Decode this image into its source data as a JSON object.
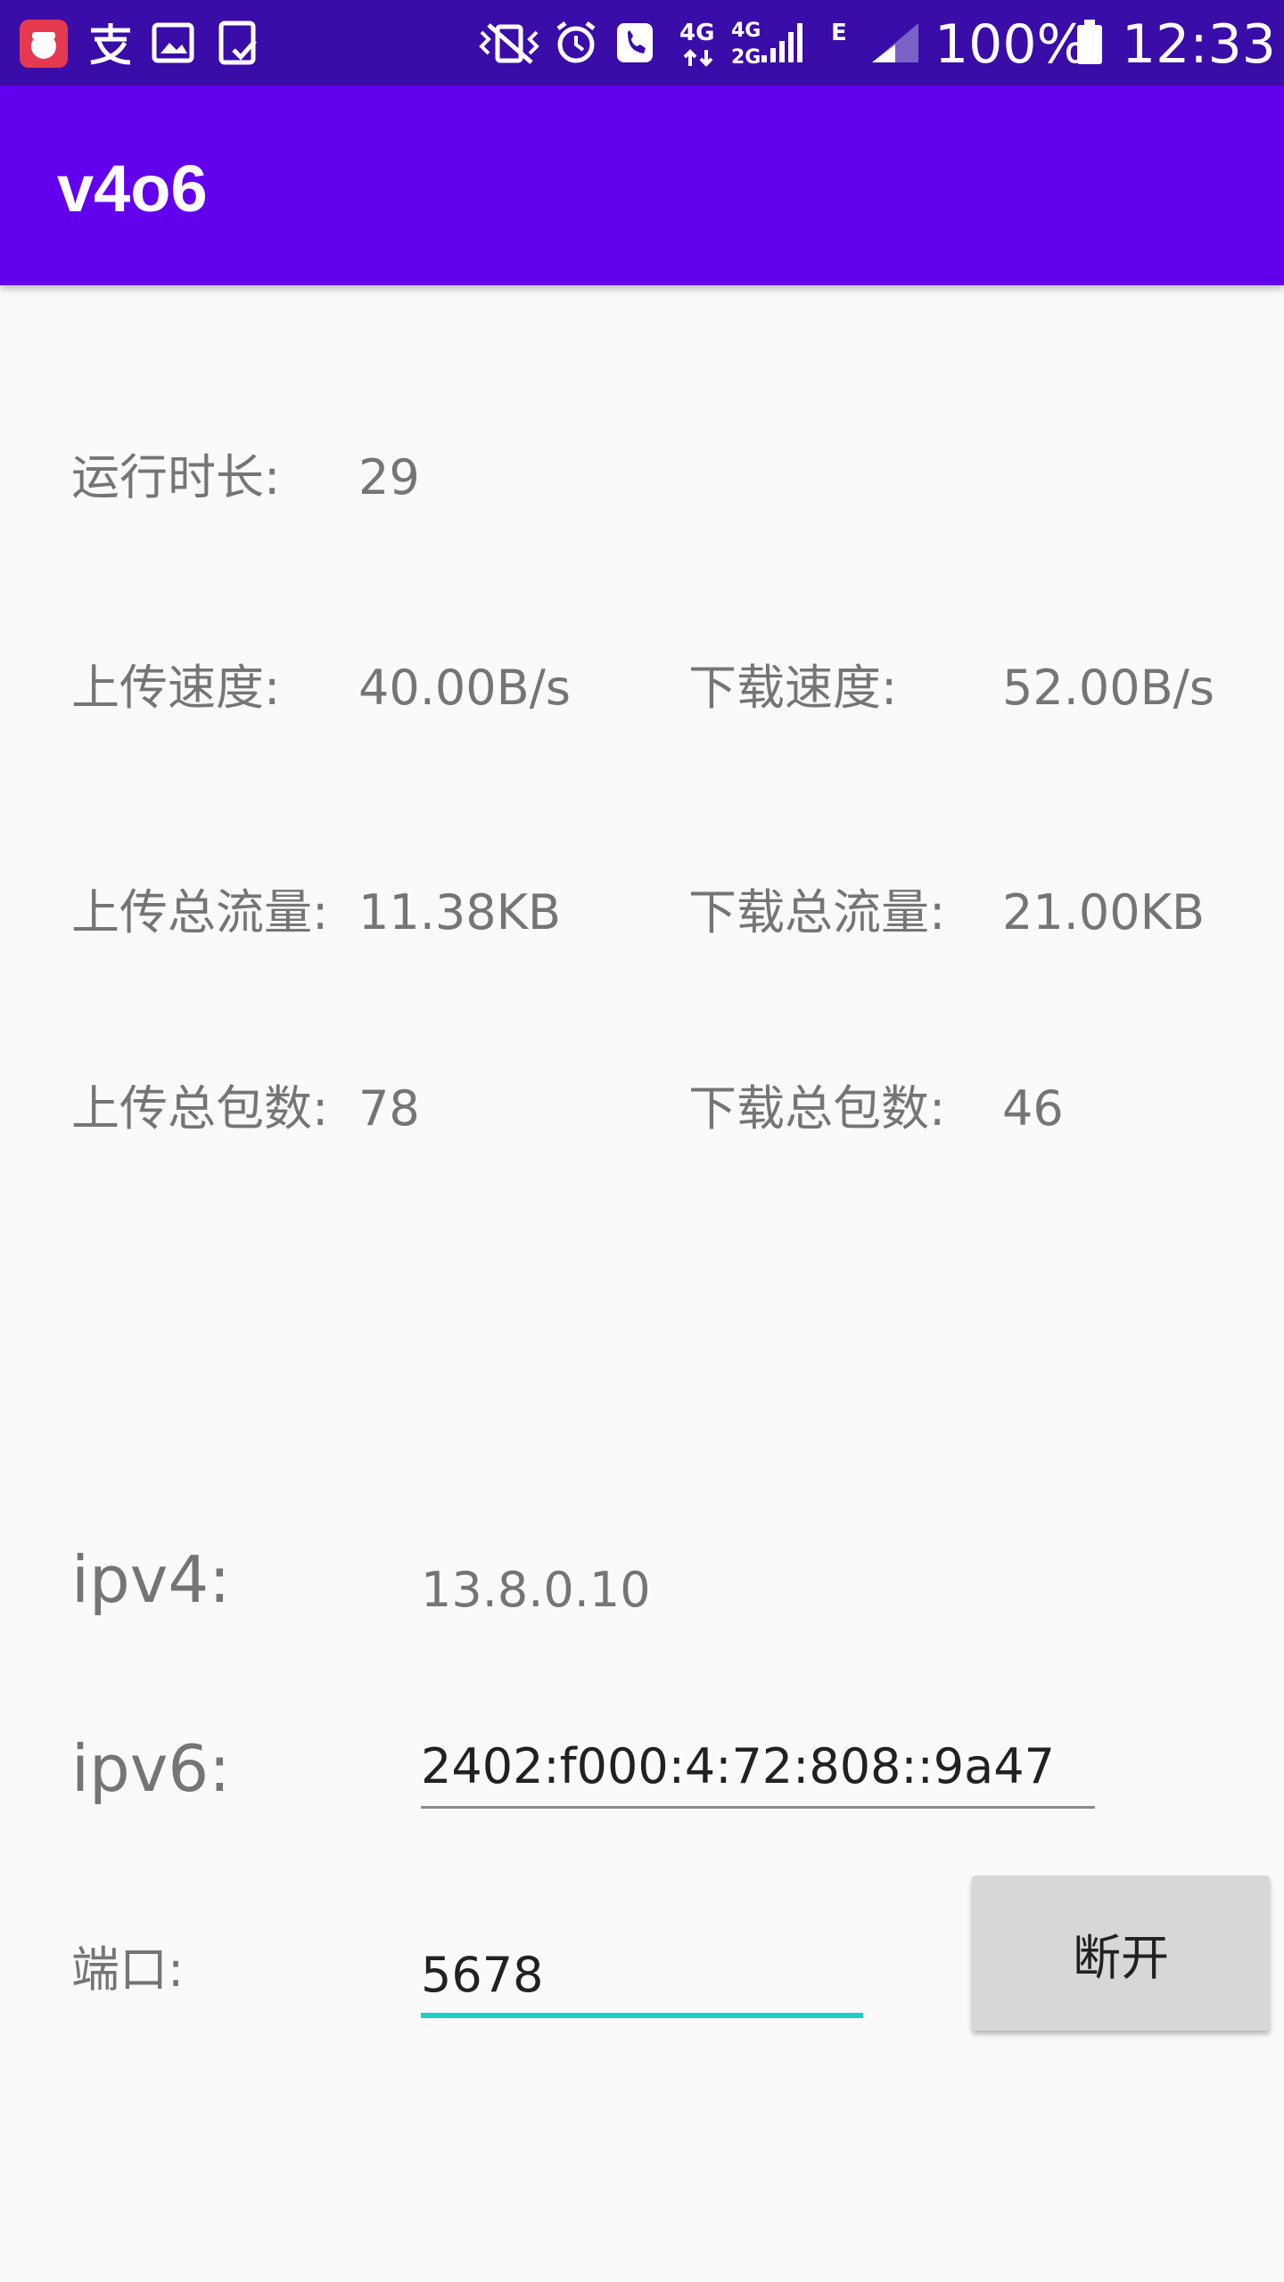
{
  "status_bar": {
    "network_4g_top": "4G",
    "network_4g_2g_top": "4G",
    "network_4g_2g_bottom": "2G",
    "network_e": "E",
    "battery": "100%",
    "time": "12:33"
  },
  "app_bar": {
    "title": "v4o6"
  },
  "stats": {
    "run_time": {
      "label": "运行时长:",
      "value": "29"
    },
    "upload_speed": {
      "label": "上传速度:",
      "value": "40.00B/s"
    },
    "download_speed": {
      "label": "下载速度:",
      "value": "52.00B/s"
    },
    "upload_total_traffic": {
      "label": "上传总流量:",
      "value": "11.38KB"
    },
    "download_total_traffic": {
      "label": "下载总流量:",
      "value": "21.00KB"
    },
    "upload_total_packets": {
      "label": "上传总包数:",
      "value": "78"
    },
    "download_total_packets": {
      "label": "下载总包数:",
      "value": "46"
    }
  },
  "connection": {
    "ipv4_label": "ipv4:",
    "ipv4_value": "13.8.0.10",
    "ipv6_label": "ipv6:",
    "ipv6_value": "2402:f000:4:72:808::9a47",
    "port_label": "端口:",
    "port_value": "5678",
    "disconnect_label": "断开"
  }
}
